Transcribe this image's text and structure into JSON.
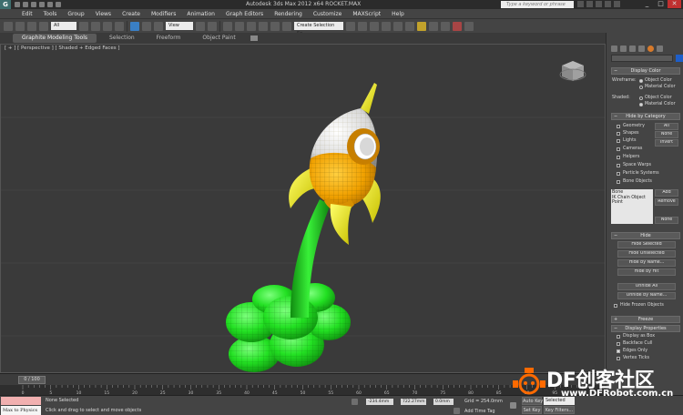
{
  "titlebar": {
    "logo": "G",
    "title": "Autodesk 3ds Max  2012 x64     ROCKET.MAX",
    "search_placeholder": "Type a keyword or phrase",
    "minimize": "_",
    "maximize": "□",
    "close": "✕"
  },
  "menu": [
    "Edit",
    "Tools",
    "Group",
    "Views",
    "Create",
    "Modifiers",
    "Animation",
    "Graph Editors",
    "Rendering",
    "Customize",
    "MAXScript",
    "Help"
  ],
  "toolbar": {
    "selection_filter": "All",
    "reference_coord": "View",
    "named_selection": "Create Selection Se"
  },
  "ribbon": {
    "tabs": [
      "Graphite Modeling Tools",
      "Selection",
      "Freeform",
      "Object Paint"
    ],
    "active_tab": "Graphite Modeling Tools"
  },
  "viewport": {
    "label": "[ + ] [ Perspective ] [ Shaded + Edged Faces ]"
  },
  "timeline": {
    "thumb": "0 / 100",
    "ticks": [
      "0",
      "5",
      "10",
      "15",
      "20",
      "25",
      "30",
      "35",
      "40",
      "45",
      "50",
      "55",
      "60",
      "65",
      "70",
      "75",
      "80",
      "85",
      "90",
      "95",
      "100"
    ]
  },
  "statusbar": {
    "maxscript_text": "Max to Physics",
    "selection_status": "None Selected",
    "prompt": "Click and drag to select and move objects",
    "x_value": "-234.4mm",
    "y_value": "722.27mm",
    "z_value": "0.0mm",
    "grid": "Grid = 254.0mm",
    "add_time_tag": "Add Time Tag",
    "auto_key": "Auto Key",
    "set_key": "Set Key",
    "selected_dropdown": "Selected",
    "key_filters": "Key Filters..."
  },
  "command_panel": {
    "display_color": {
      "title": "Display Color",
      "wireframe_label": "Wireframe:",
      "shaded_label": "Shaded:",
      "object_color": "Object Color",
      "material_color": "Material Color"
    },
    "hide_by_category": {
      "title": "Hide by Category",
      "items": [
        "Geometry",
        "Shapes",
        "Lights",
        "Cameras",
        "Helpers",
        "Space Warps",
        "Particle Systems",
        "Bone Objects"
      ],
      "buttons": [
        "All",
        "None",
        "Invert"
      ],
      "list_items": [
        "Bone",
        "IK Chain Object",
        "Point"
      ],
      "add": "Add",
      "remove": "Remove",
      "none": "None"
    },
    "hide": {
      "title": "Hide",
      "buttons": [
        "Hide Selected",
        "Hide Unselected",
        "Hide by Name...",
        "Hide by Hit",
        "Unhide All",
        "Unhide by Name..."
      ],
      "hide_frozen": "Hide Frozen Objects"
    },
    "freeze": {
      "title": "Freeze"
    },
    "display_properties": {
      "title": "Display Properties",
      "items": [
        "Display as Box",
        "Backface Cull",
        "Edges Only",
        "Vertex Ticks"
      ]
    }
  },
  "watermark": {
    "title": "DF创客社区",
    "url": "www.DFRobot.com.cn"
  },
  "colors": {
    "viewport_bg": "#3a3a3a",
    "panel_bg": "#444444",
    "rocket_orange": "#f0a000",
    "rocket_yellow": "#e8e000",
    "exhaust_green": "#22e022"
  }
}
